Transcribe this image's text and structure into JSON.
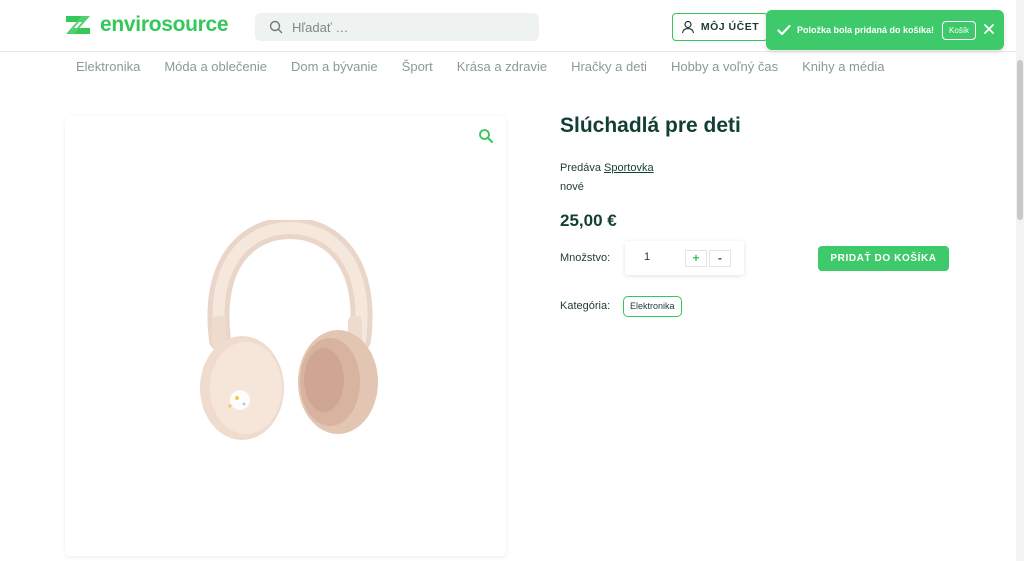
{
  "header": {
    "logo_text": "envirosource",
    "search_placeholder": "Hľadať …",
    "account_label": "MÔJ ÚČET"
  },
  "toast": {
    "message": "Položka bola pridaná do košíka!",
    "cart_button": "Košík"
  },
  "nav": {
    "items": [
      "Elektronika",
      "Móda a oblečenie",
      "Dom a bývanie",
      "Šport",
      "Krása a zdravie",
      "Hračky a deti",
      "Hobby a voľný čas",
      "Knihy a média"
    ]
  },
  "product": {
    "title": "Slúchadlá pre deti",
    "seller_prefix": "Predáva",
    "seller_name": "Sportovka",
    "condition": "nové",
    "price": "25,00 €",
    "quantity_label": "Množstvo:",
    "quantity_value": "1",
    "plus": "+",
    "minus": "-",
    "add_to_cart": "PRIDAŤ DO KOŠÍKA",
    "category_label": "Kategória:",
    "category": "Elektronika"
  },
  "colors": {
    "brand_green": "#34c759",
    "dark_green": "#123f35",
    "toast_green": "#3ec96b"
  }
}
